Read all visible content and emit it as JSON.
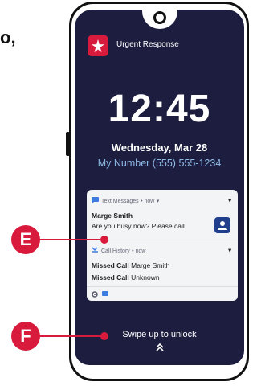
{
  "corner_text": "o,",
  "app": {
    "title": "Urgent Response"
  },
  "lockscreen": {
    "time": "12:45",
    "date": "Wednesday, Mar 28",
    "my_number": "My Number (555) 555-1234"
  },
  "notifications": {
    "text_messages": {
      "app_label": "Text Messages",
      "time_label": "• now",
      "sender": "Marge Smith",
      "message": "Are you busy now? Please call"
    },
    "call_history": {
      "app_label": "Call History",
      "time_label": "• now",
      "items": [
        {
          "prefix": "Missed Call",
          "name": "Marge Smith"
        },
        {
          "prefix": "Missed Call",
          "name": "Unknown"
        }
      ]
    }
  },
  "unlock": {
    "label": "Swipe up to unlock",
    "chevron": "⌃⌃"
  },
  "callouts": [
    {
      "letter": "E"
    },
    {
      "letter": "F"
    }
  ],
  "colors": {
    "screen": "#1d1e3f",
    "accent": "#d81b3c",
    "number": "#8fb9e6"
  }
}
